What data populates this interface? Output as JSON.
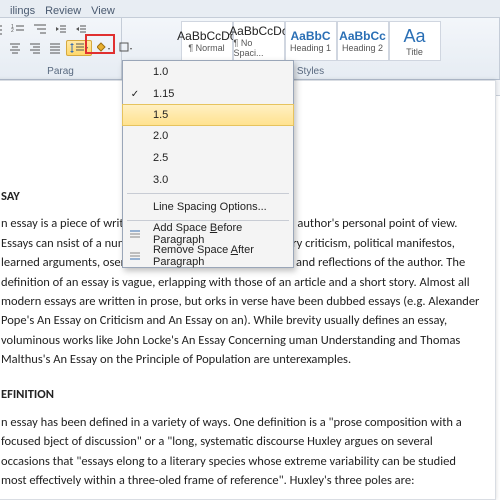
{
  "tabs": {
    "mailings": "ilings",
    "review": "Review",
    "view": "View"
  },
  "ribbon": {
    "paragraph_label": "Parag",
    "styles_label": "Styles",
    "styles": [
      {
        "preview": "AaBbCcDc",
        "name": "¶ Normal"
      },
      {
        "preview": "AaBbCcDc",
        "name": "¶ No Spaci..."
      },
      {
        "preview": "AaBbC",
        "name": "Heading 1"
      },
      {
        "preview": "AaBbCc",
        "name": "Heading 2"
      },
      {
        "preview": "Aa",
        "name": "Title"
      }
    ]
  },
  "dropdown": {
    "items": [
      "1.0",
      "1.15",
      "1.5",
      "2.0",
      "2.5",
      "3.0"
    ],
    "checked": "1.15",
    "highlighted": "1.5",
    "options_label": "Line Spacing Options...",
    "add_before": "Add Space Before Paragraph",
    "remove_after": "Remove Space After Paragraph"
  },
  "doc": {
    "h1": "SAY",
    "p1": "n essay is a piece of writing which is often written from an author's personal point of view. Essays can nsist of a number of elements, including: literary criticism, political manifestos, learned arguments, oservations of daily life, recollections, and reflections of the author. The definition of an essay is vague, erlapping with those of an article and a short story. Almost all modern essays are written in prose, but orks in verse have been dubbed essays (e.g. Alexander Pope's An Essay on Criticism and An Essay on an). While brevity usually defines an essay, voluminous works like John Locke's An Essay Concerning uman Understanding and Thomas Malthus's An Essay on the Principle of Population are unterexamples.",
    "h2": "EFINITION",
    "p2": "n essay has been defined in a variety of ways. One definition is a \"prose composition with a focused bject of discussion\" or a \"long, systematic discourse Huxley argues on several occasions that \"essays elong to a literary species whose extreme variability can be studied most effectively within a three-oled frame of reference\". Huxley's three poles are:"
  }
}
